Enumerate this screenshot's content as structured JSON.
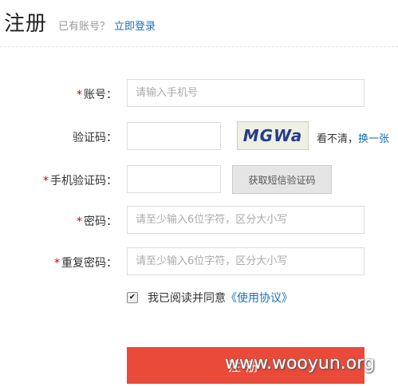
{
  "header": {
    "title": "注册",
    "has_account": "已有账号？",
    "login_link": "立即登录"
  },
  "form": {
    "required_mark": "*",
    "account": {
      "label": "账号：",
      "placeholder": "请输入手机号"
    },
    "captcha": {
      "label": "验证码：",
      "image_text": "MGWa",
      "hint": "看不清，",
      "refresh": "换一张"
    },
    "sms": {
      "label": "手机验证码：",
      "button": "获取短信验证码"
    },
    "password": {
      "label": "密码：",
      "placeholder": "请至少输入6位字符，区分大小写"
    },
    "confirm": {
      "label": "重复密码：",
      "placeholder": "请至少输入6位字符，区分大小写"
    },
    "agreement": {
      "checked": true,
      "text": "我已阅读并同意",
      "link": "《使用协议》"
    },
    "submit": "注册"
  },
  "watermark": "www.wooyun.org",
  "colors": {
    "accent": "#e94a3a",
    "link": "#1a6fb5",
    "required": "#cc0000"
  }
}
